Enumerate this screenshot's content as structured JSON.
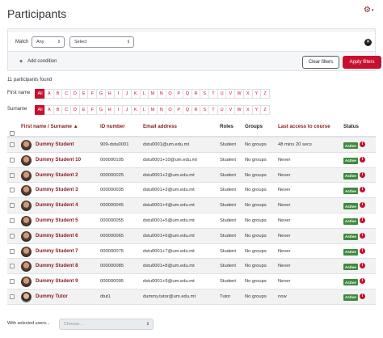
{
  "page": {
    "title": "Participants"
  },
  "filter": {
    "match_label": "Match",
    "match_value": "Any",
    "select_value": "Select",
    "add_condition": "Add condition",
    "clear_label": "Clear filters",
    "apply_label": "Apply filters"
  },
  "count_text": "11 participants found",
  "initials": {
    "firstname_label": "First name",
    "surname_label": "Surname",
    "all_label": "All",
    "letters": [
      "A",
      "B",
      "C",
      "D",
      "E",
      "F",
      "G",
      "H",
      "I",
      "J",
      "K",
      "L",
      "M",
      "N",
      "O",
      "P",
      "Q",
      "R",
      "S",
      "T",
      "U",
      "V",
      "W",
      "X",
      "Y",
      "Z"
    ]
  },
  "table": {
    "headers": {
      "name": "First name / Surname",
      "id": "ID number",
      "email": "Email address",
      "roles": "Roles",
      "groups": "Groups",
      "last_access": "Last access to course",
      "status": "Status"
    },
    "rows": [
      {
        "name": "Dummy Student",
        "id": "909-dstu0001",
        "email": "dstu0001@um.edu.mt",
        "role": "Student",
        "groups": "No groups",
        "last": "48 mins 20 secs",
        "status": "Active"
      },
      {
        "name": "Dummy Student 10",
        "id": "000000105",
        "email": "dstu0001+10@um.edu.mt",
        "role": "Student",
        "groups": "No groups",
        "last": "Never",
        "status": "Active"
      },
      {
        "name": "Dummy Student 2",
        "id": "000000025",
        "email": "dstu0001+2@um.edu.mt",
        "role": "Student",
        "groups": "No groups",
        "last": "Never",
        "status": "Active"
      },
      {
        "name": "Dummy Student 3",
        "id": "000000035",
        "email": "dstu0001+3@um.edu.mt",
        "role": "Student",
        "groups": "No groups",
        "last": "Never",
        "status": "Active"
      },
      {
        "name": "Dummy Student 4",
        "id": "000000045",
        "email": "dstu0001+4@um.edu.mt",
        "role": "Student",
        "groups": "No groups",
        "last": "Never",
        "status": "Active"
      },
      {
        "name": "Dummy Student 5",
        "id": "000000055",
        "email": "dstu0001+5@um.edu.mt",
        "role": "Student",
        "groups": "No groups",
        "last": "Never",
        "status": "Active"
      },
      {
        "name": "Dummy Student 6",
        "id": "000000065",
        "email": "dstu0001+6@um.edu.mt",
        "role": "Student",
        "groups": "No groups",
        "last": "Never",
        "status": "Active"
      },
      {
        "name": "Dummy Student 7",
        "id": "000000075",
        "email": "dstu0001+7@um.edu.mt",
        "role": "Student",
        "groups": "No groups",
        "last": "Never",
        "status": "Active"
      },
      {
        "name": "Dummy Student 8",
        "id": "000000085",
        "email": "dstu0001+8@um.edu.mt",
        "role": "Student",
        "groups": "No groups",
        "last": "Never",
        "status": "Active"
      },
      {
        "name": "Dummy Student 9",
        "id": "000000095",
        "email": "dstu0001+9@um.edu.mt",
        "role": "Student",
        "groups": "No groups",
        "last": "Never",
        "status": "Active"
      },
      {
        "name": "Dummy Tutor",
        "id": "dtut1",
        "email": "dummy.tutor@um.edu.mt",
        "role": "Tutor",
        "groups": "No groups",
        "last": "now",
        "status": "Active"
      }
    ]
  },
  "bulk": {
    "label": "With selected users...",
    "choose": "Choose..."
  }
}
